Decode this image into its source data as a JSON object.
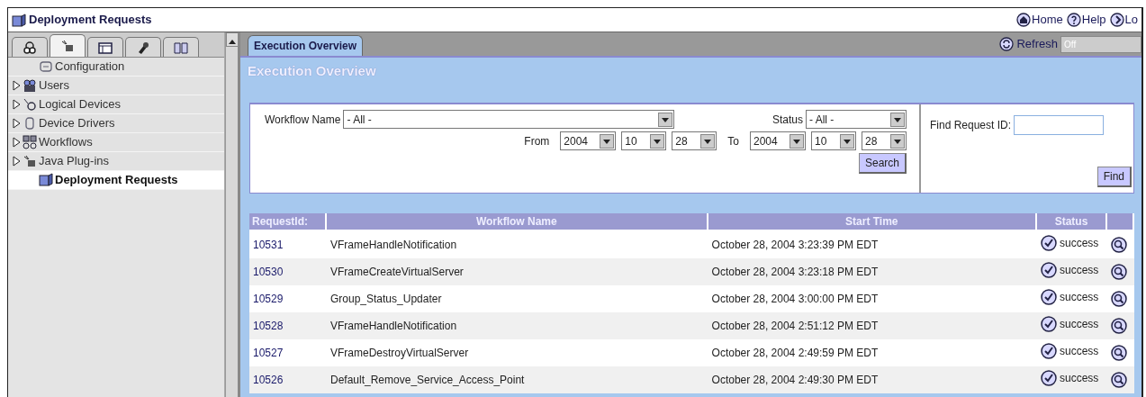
{
  "window": {
    "title": "Deployment Requests"
  },
  "header_links": [
    {
      "label": "Home",
      "kind": "home"
    },
    {
      "label": "Help",
      "kind": "help"
    },
    {
      "label": "Lo",
      "kind": "logout"
    }
  ],
  "sidebar": {
    "tabs": [
      {
        "kind": "network",
        "selected": false
      },
      {
        "kind": "plugin",
        "selected": true
      },
      {
        "kind": "window",
        "selected": false
      },
      {
        "kind": "tools",
        "selected": false
      },
      {
        "kind": "book",
        "selected": false
      }
    ],
    "items": [
      {
        "label": "Configuration",
        "kind": "config",
        "expandable": false,
        "selected": false
      },
      {
        "label": "Users",
        "kind": "users",
        "expandable": true,
        "selected": false
      },
      {
        "label": "Logical Devices",
        "kind": "devices",
        "expandable": true,
        "selected": false
      },
      {
        "label": "Device Drivers",
        "kind": "drivers",
        "expandable": true,
        "selected": false
      },
      {
        "label": "Workflows",
        "kind": "workflows",
        "expandable": true,
        "selected": false
      },
      {
        "label": "Java Plug-ins",
        "kind": "plugin",
        "expandable": true,
        "selected": false
      },
      {
        "label": "Deployment Requests",
        "kind": "requests",
        "expandable": false,
        "selected": true
      }
    ]
  },
  "main": {
    "tabs": [
      {
        "label": "Execution Overview",
        "selected": true
      }
    ],
    "refresh": {
      "label": "Refresh",
      "value": "Off"
    },
    "heading": "Execution Overview",
    "filters": {
      "workflow_label": "Workflow Name",
      "workflow_value": "- All -",
      "status_label": "Status",
      "status_value": "- All -",
      "from_label": "From",
      "from": [
        "2004",
        "10",
        "28"
      ],
      "to_label": "To",
      "to": [
        "2004",
        "10",
        "28"
      ],
      "search_button": "Search",
      "find_label": "Find Request ID:",
      "find_button": "Find"
    },
    "table": {
      "columns": [
        "RequestId:",
        "Workflow Name",
        "Start Time",
        "Status"
      ],
      "rows": [
        {
          "id": "10531",
          "workflow": "VFrameHandleNotification",
          "start_time": "October 28, 2004 3:23:39 PM EDT",
          "status": "success"
        },
        {
          "id": "10530",
          "workflow": "VFrameCreateVirtualServer",
          "start_time": "October 28, 2004 3:23:18 PM EDT",
          "status": "success"
        },
        {
          "id": "10529",
          "workflow": "Group_Status_Updater",
          "start_time": "October 28, 2004 3:00:00 PM EDT",
          "status": "success"
        },
        {
          "id": "10528",
          "workflow": "VFrameHandleNotification",
          "start_time": "October 28, 2004 2:51:12 PM EDT",
          "status": "success"
        },
        {
          "id": "10527",
          "workflow": "VFrameDestroyVirtualServer",
          "start_time": "October 28, 2004 2:49:59 PM EDT",
          "status": "success"
        },
        {
          "id": "10526",
          "workflow": "Default_Remove_Service_Access_Point",
          "start_time": "October 28, 2004 2:49:30 PM EDT",
          "status": "success"
        }
      ]
    }
  }
}
